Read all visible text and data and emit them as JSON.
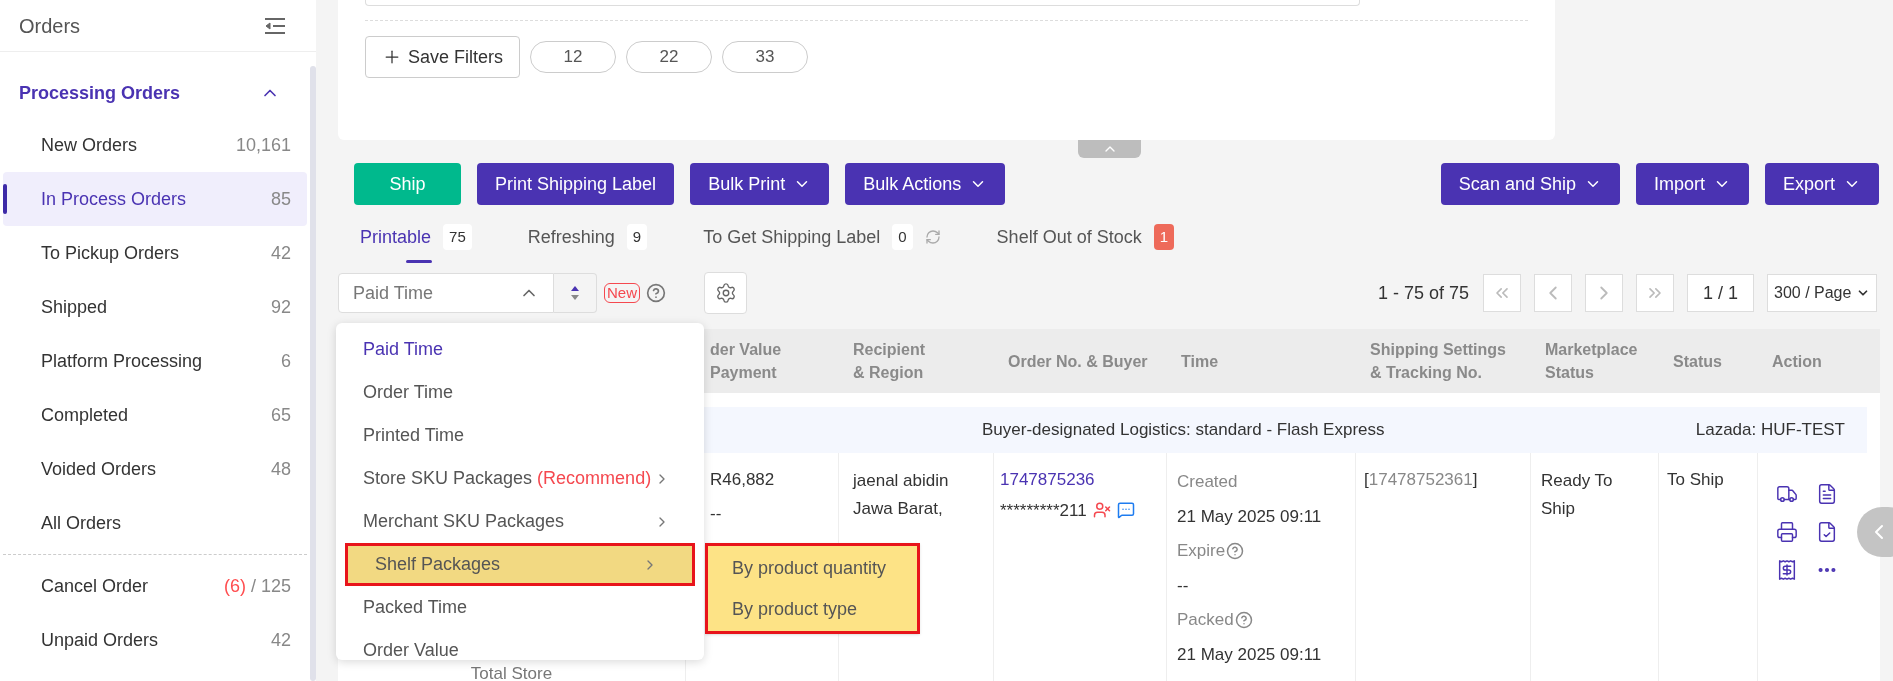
{
  "sidebar": {
    "title": "Orders",
    "section": {
      "label": "Processing Orders",
      "expanded": true
    },
    "items": [
      {
        "label": "New Orders",
        "count": "10,161",
        "selected": false
      },
      {
        "label": "In Process Orders",
        "count": "85",
        "selected": true
      },
      {
        "label": "To Pickup Orders",
        "count": "42",
        "selected": false
      },
      {
        "label": "Shipped",
        "count": "92",
        "selected": false
      },
      {
        "label": "Platform Processing",
        "count": "6",
        "selected": false
      },
      {
        "label": "Completed",
        "count": "65",
        "selected": false
      },
      {
        "label": "Voided Orders",
        "count": "48",
        "selected": false
      },
      {
        "label": "All Orders",
        "selected": false
      }
    ],
    "other_items": [
      {
        "label": "Cancel Order",
        "alert": "(6)",
        "count": "/ 125"
      },
      {
        "label": "Unpaid Orders",
        "count": "42"
      }
    ]
  },
  "filters": {
    "save_button": "Save Filters",
    "saved": [
      "12",
      "22",
      "33"
    ]
  },
  "toolbar": {
    "left": [
      {
        "label": "Ship",
        "kind": "success",
        "dropdown": false
      },
      {
        "label": "Print Shipping Label",
        "kind": "primary",
        "dropdown": false
      },
      {
        "label": "Bulk Print",
        "kind": "primary",
        "dropdown": true
      },
      {
        "label": "Bulk Actions",
        "kind": "primary",
        "dropdown": true
      }
    ],
    "right": [
      {
        "label": "Scan and Ship",
        "kind": "primary",
        "dropdown": true
      },
      {
        "label": "Import",
        "kind": "primary",
        "dropdown": true
      },
      {
        "label": "Export",
        "kind": "primary",
        "dropdown": true
      }
    ]
  },
  "status_tabs": [
    {
      "label": "Printable",
      "count": "75",
      "selected": true,
      "kind": "plain"
    },
    {
      "label": "Refreshing",
      "count": "9",
      "selected": false,
      "kind": "plain"
    },
    {
      "label": "To Get Shipping Label",
      "count": "0",
      "selected": false,
      "kind": "refresh"
    },
    {
      "label": "Shelf Out of Stock",
      "count": "1",
      "selected": false,
      "kind": "alert"
    }
  ],
  "sort": {
    "value": "Paid Time",
    "expanded": true,
    "badge": "New"
  },
  "pagination": {
    "range": "1 - 75 of 75",
    "page": "1 / 1",
    "page_size": "300 / Page"
  },
  "dropdown": {
    "options": [
      {
        "label": "Paid Time",
        "selected": true,
        "highlighted": false,
        "submenu": false
      },
      {
        "label": "Order Time",
        "selected": false,
        "highlighted": false,
        "submenu": false
      },
      {
        "label": "Printed Time",
        "selected": false,
        "highlighted": false,
        "submenu": false
      },
      {
        "label": "Store SKU Packages",
        "note": "(Recommend)",
        "selected": false,
        "highlighted": false,
        "submenu": true
      },
      {
        "label": "Merchant SKU Packages",
        "selected": false,
        "highlighted": false,
        "submenu": true
      },
      {
        "label": "Shelf Packages",
        "selected": false,
        "highlighted": true,
        "submenu": true
      },
      {
        "label": "Packed Time",
        "selected": false,
        "highlighted": false,
        "submenu": false
      },
      {
        "label": "Order Value",
        "selected": false,
        "highlighted": false,
        "submenu": false
      }
    ],
    "submenu": [
      "By product quantity",
      "By product type"
    ]
  },
  "table": {
    "columns": [
      [
        "der Value",
        "Payment"
      ],
      [
        "Recipient",
        "& Region"
      ],
      [
        "Order No. & Buyer"
      ],
      [
        "Time"
      ],
      [
        "Shipping Settings",
        "& Tracking No."
      ],
      [
        "Marketplace",
        "Status"
      ],
      [
        "Status"
      ],
      [
        "Action"
      ]
    ],
    "group": {
      "logistics": "Buyer-designated Logistics: standard - Flash Express",
      "store": "Lazada: HUF-TEST"
    },
    "row": {
      "column_1": "Total Store",
      "value": "R46,882",
      "payment": "--",
      "recipient": [
        "jaenal abidin",
        "Jawa Barat,"
      ],
      "order_no": "1747875236",
      "buyer": "*********211",
      "time": [
        {
          "label": "Created",
          "value": "21 May 2025 09:11",
          "help": false
        },
        {
          "label": "Expire",
          "value": "--",
          "help": true
        },
        {
          "label": "Packed",
          "value": "21 May 2025 09:11",
          "help": true
        }
      ],
      "tracking": {
        "open": "[",
        "number": "17478752361",
        "close": "]"
      },
      "marketplace_status": "Ready To Ship",
      "status": "To Ship"
    }
  }
}
